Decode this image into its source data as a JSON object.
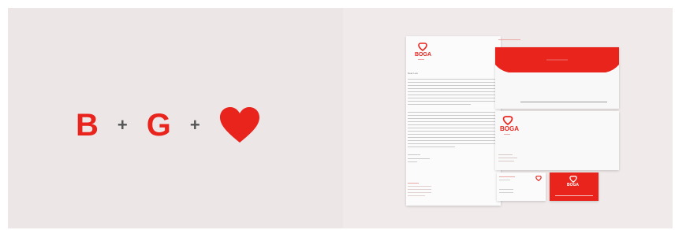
{
  "equation": {
    "first": "B",
    "operator_1": "+",
    "second": "G",
    "operator_2": "+",
    "symbol": "heart-icon"
  },
  "brand": {
    "name": "BOGA",
    "color": "#e8241d",
    "grey": "#555555"
  },
  "letter": {
    "greeting": "Dear Luis"
  }
}
